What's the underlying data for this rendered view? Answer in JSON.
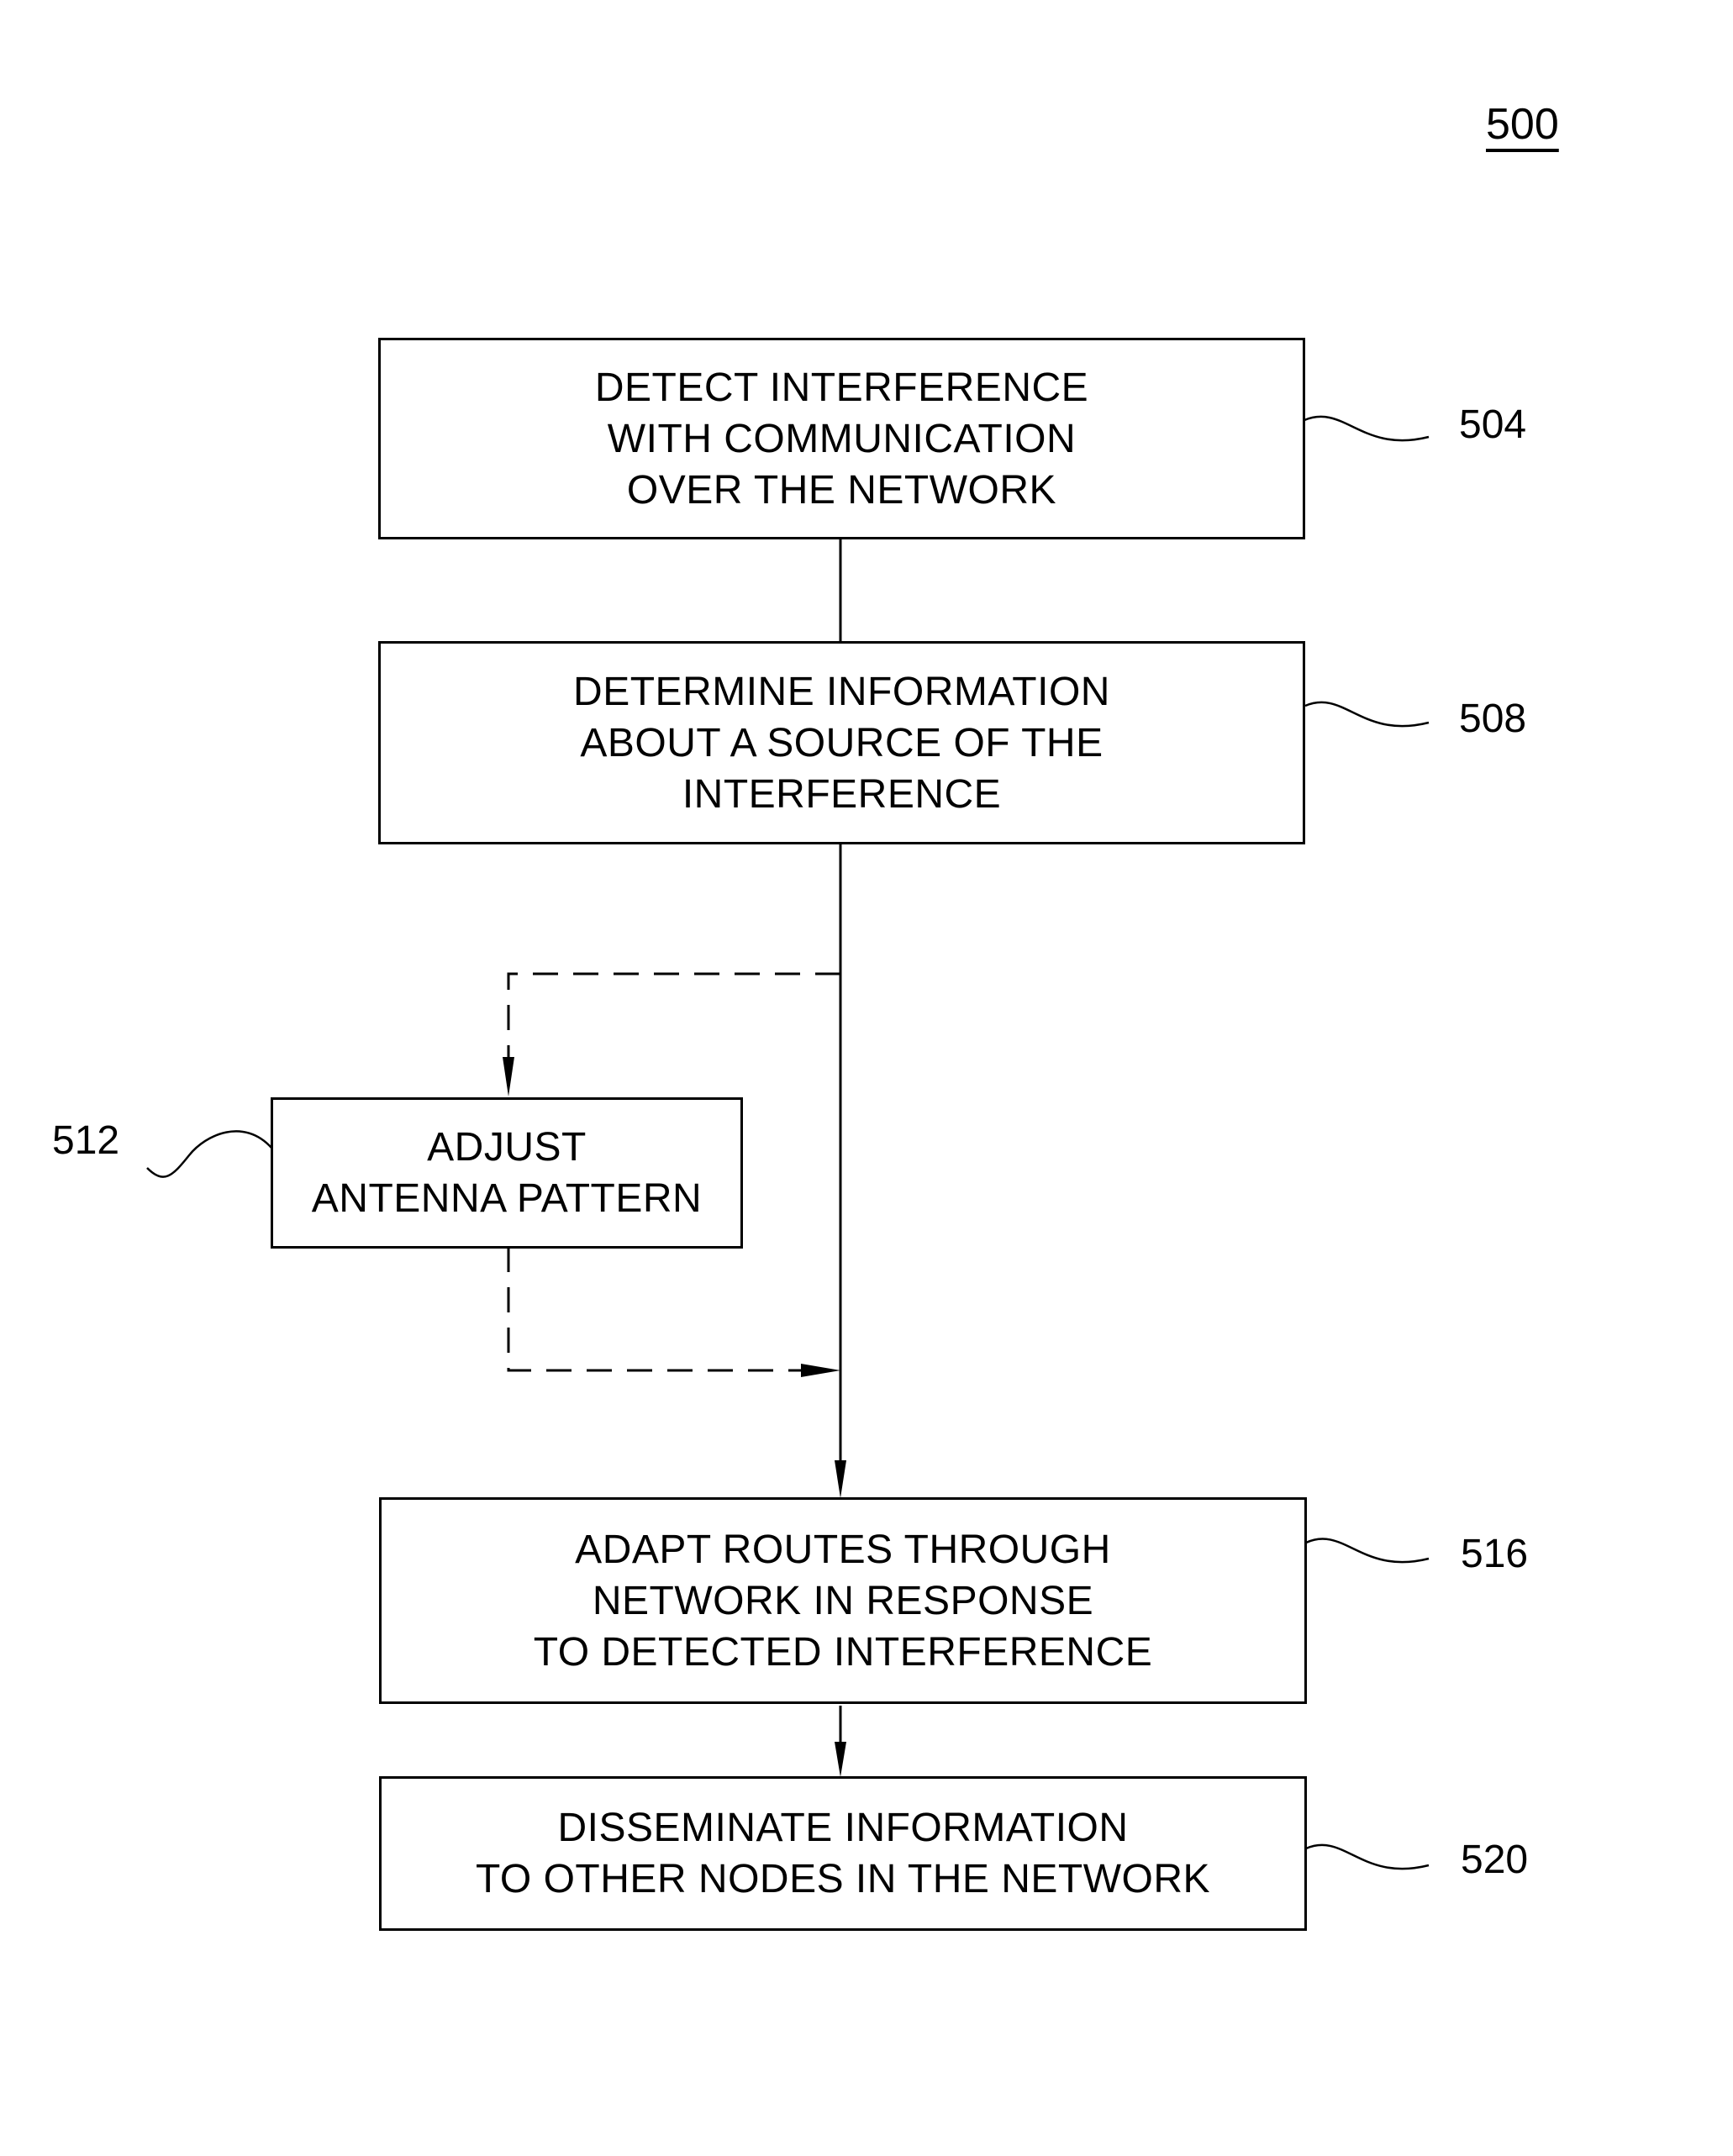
{
  "figure": {
    "number": "500"
  },
  "steps": [
    {
      "ref": "504",
      "lines": [
        "DETECT INTERFERENCE",
        "WITH COMMUNICATION",
        "OVER THE NETWORK"
      ],
      "optional": false
    },
    {
      "ref": "508",
      "lines": [
        "DETERMINE INFORMATION",
        "ABOUT A SOURCE OF THE",
        "INTERFERENCE"
      ],
      "optional": false
    },
    {
      "ref": "512",
      "lines": [
        "ADJUST",
        "ANTENNA PATTERN"
      ],
      "optional": true
    },
    {
      "ref": "516",
      "lines": [
        "ADAPT ROUTES THROUGH",
        "NETWORK IN RESPONSE",
        "TO DETECTED INTERFERENCE"
      ],
      "optional": false
    },
    {
      "ref": "520",
      "lines": [
        "DISSEMINATE INFORMATION",
        "TO OTHER NODES IN THE NETWORK"
      ],
      "optional": false
    }
  ],
  "flow": [
    {
      "from": "504",
      "to": "508",
      "style": "solid"
    },
    {
      "from": "508",
      "to": "512",
      "style": "dashed"
    },
    {
      "from": "512",
      "to": "516",
      "style": "dashed"
    },
    {
      "from": "508",
      "to": "516",
      "style": "solid"
    },
    {
      "from": "516",
      "to": "520",
      "style": "solid"
    }
  ]
}
